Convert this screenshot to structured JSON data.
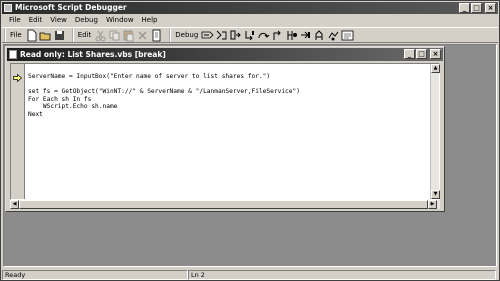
{
  "window": {
    "title": "Microsoft Script Debugger",
    "controls": [
      "minimize",
      "maximize",
      "close"
    ]
  },
  "menubar": {
    "items": [
      "File",
      "Edit",
      "View",
      "Debug",
      "Window",
      "Help"
    ]
  },
  "toolbar": {
    "file_label": "File",
    "edit_label": "Edit",
    "debug_label": "Debug",
    "file_buttons": [
      "new-document-icon",
      "open-folder-icon",
      "save-disk-icon"
    ],
    "edit_buttons": [
      "cut-icon",
      "copy-icon",
      "paste-icon",
      "delete-icon",
      "find-icon"
    ],
    "debug_buttons": [
      "run-icon",
      "stop-debugging-icon",
      "break-at-next-icon",
      "step-into-icon",
      "step-over-icon",
      "step-out-icon",
      "toggle-breakpoint-icon",
      "clear-breakpoints-icon",
      "running-documents-icon",
      "call-stack-icon",
      "command-window-icon"
    ]
  },
  "child_window": {
    "title": "Read only: List Shares.vbs [break]",
    "code_lines": [
      "ServerName = InputBox(\"Enter name of server to list shares for.\")",
      "",
      "set fs = GetObject(\"WinNT://\" & ServerName & \"/LanmanServer,FileService\")",
      "For Each sh In fs",
      "    WScript.Echo sh.name",
      "Next"
    ]
  },
  "statusbar": {
    "status": "Ready",
    "position": "Ln 2"
  },
  "colors": {
    "desktop": "#8c8c8c",
    "face": "#d4d0c8",
    "title_active": "#2b2b2b"
  }
}
